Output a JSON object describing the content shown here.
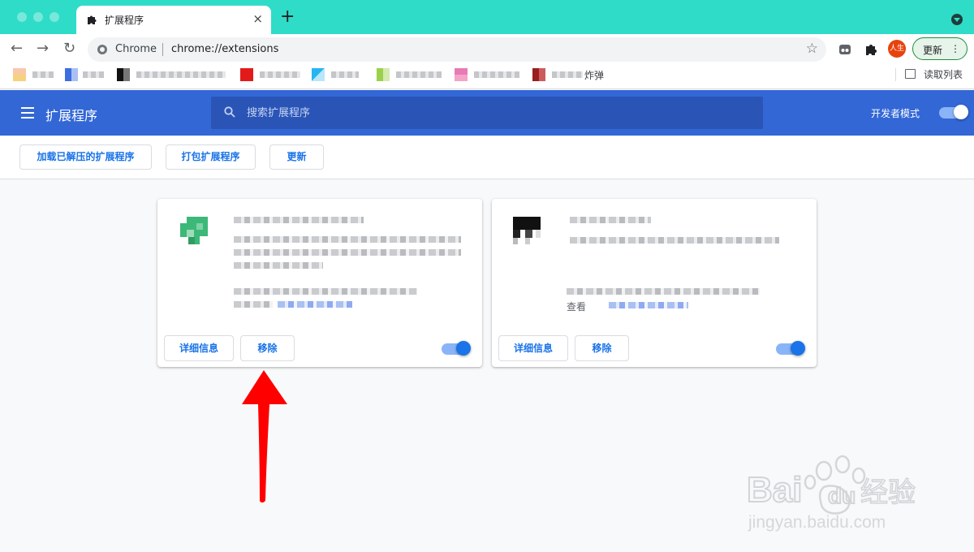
{
  "browser": {
    "tab": {
      "title": "扩展程序",
      "icon": "puzzle-icon",
      "close": "×"
    },
    "new_tab": "+",
    "omnibox": {
      "scheme_label": "Chrome",
      "url": "chrome://extensions",
      "star": "☆"
    },
    "profile_label": "人生",
    "update_button": {
      "label": "更新",
      "menu": "⋮"
    },
    "nav": {
      "back": "←",
      "forward": "→",
      "reload": "↻"
    },
    "bookmarks_bar": {
      "visible_suffix": "炸弹",
      "reading_list": "读取列表"
    }
  },
  "extensions_page": {
    "title": "扩展程序",
    "search_placeholder": "搜索扩展程序",
    "developer_mode_label": "开发者模式",
    "developer_mode": true,
    "actions": [
      "加载已解压的扩展程序",
      "打包扩展程序",
      "更新"
    ],
    "cards": [
      {
        "details_button": "详细信息",
        "remove_button": "移除",
        "enabled": true,
        "icon": "green-extension-icon"
      },
      {
        "details_button": "详细信息",
        "remove_button": "移除",
        "enabled": true,
        "icon": "black-extension-icon",
        "visible_prefix": "查看"
      }
    ]
  },
  "colors": {
    "tab_strip": "#2fdcc8",
    "header_blue": "#3367d6",
    "link_blue": "#1a73e8",
    "arrow_red": "#ff0000"
  },
  "watermark": {
    "brand": "Bai",
    "brand_suffix": "du",
    "product": "经验",
    "url": "jingyan.baidu.com"
  }
}
